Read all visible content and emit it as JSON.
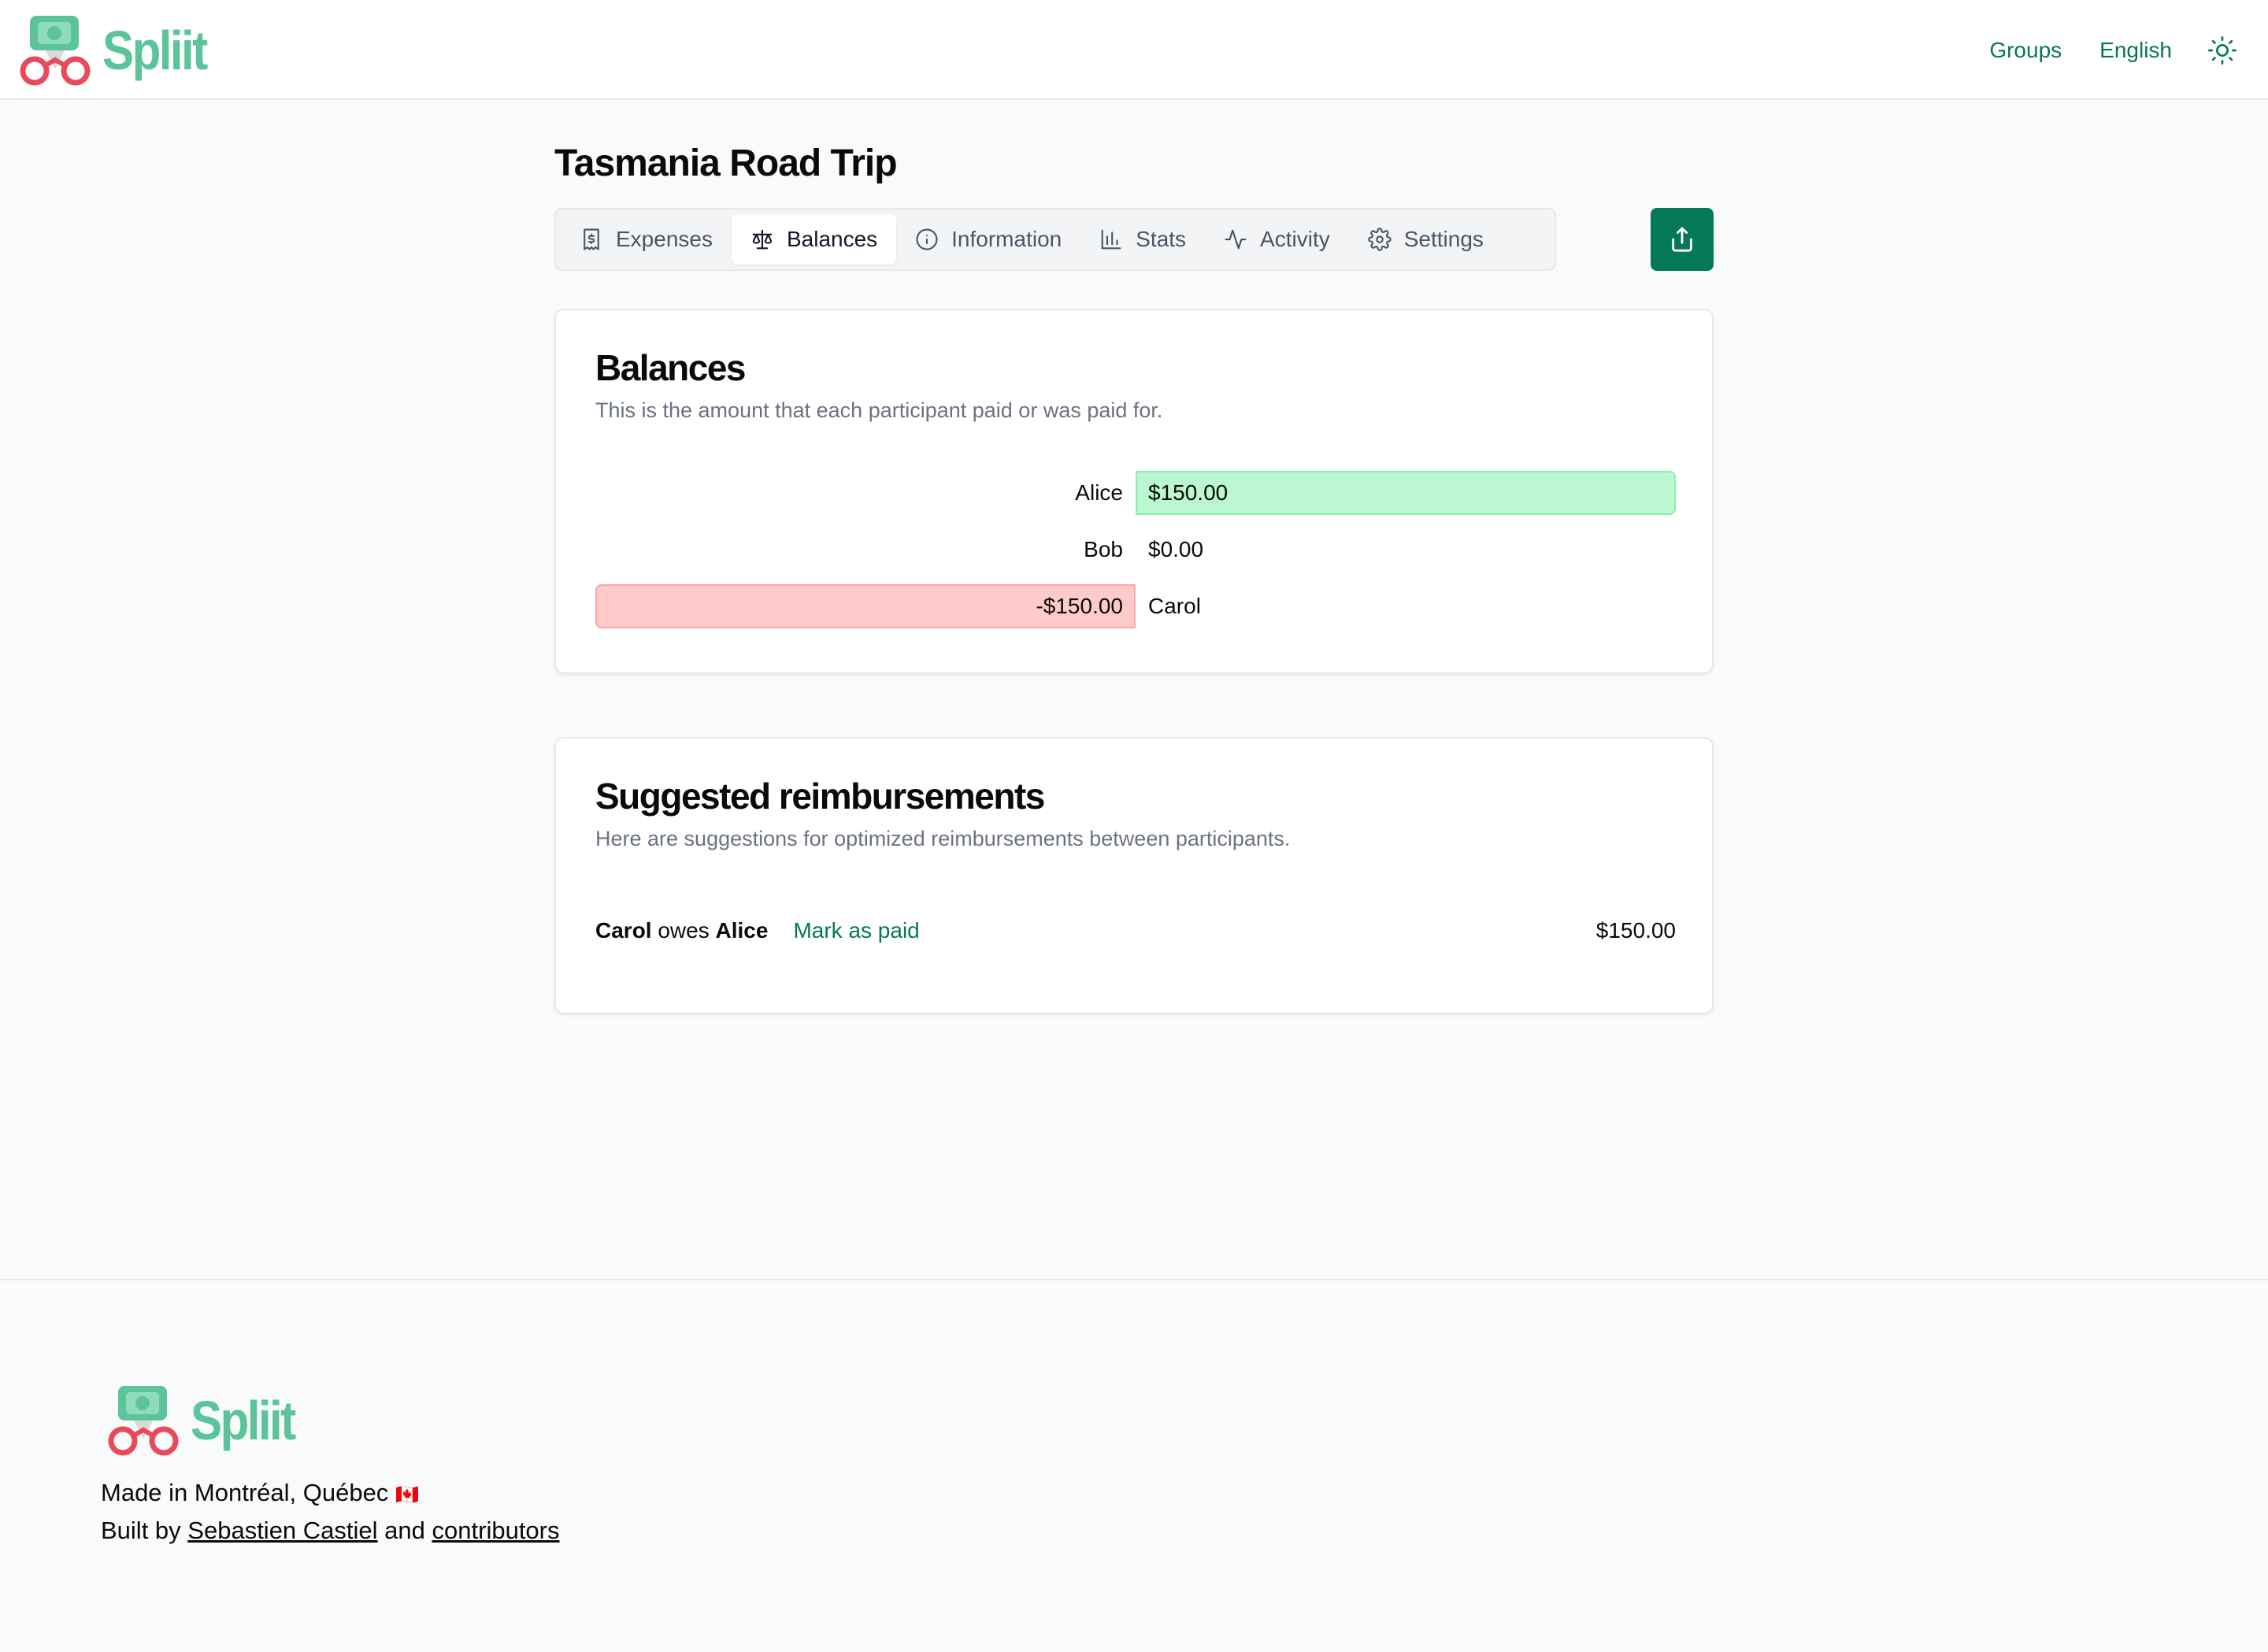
{
  "header": {
    "logo_text": "Spliit",
    "nav": {
      "groups": "Groups",
      "language": "English"
    }
  },
  "group": {
    "title": "Tasmania Road Trip"
  },
  "tabs": [
    {
      "label": "Expenses",
      "icon": "receipt-icon"
    },
    {
      "label": "Balances",
      "icon": "scale-icon",
      "active": true
    },
    {
      "label": "Information",
      "icon": "info-icon"
    },
    {
      "label": "Stats",
      "icon": "bar-chart-icon"
    },
    {
      "label": "Activity",
      "icon": "activity-icon"
    },
    {
      "label": "Settings",
      "icon": "gear-icon"
    }
  ],
  "balances": {
    "title": "Balances",
    "description": "This is the amount that each participant paid or was paid for.",
    "max_abs": 150,
    "rows": [
      {
        "name": "Alice",
        "amount": 150,
        "label": "$150.00"
      },
      {
        "name": "Bob",
        "amount": 0,
        "label": "$0.00"
      },
      {
        "name": "Carol",
        "amount": -150,
        "label": "-$150.00"
      }
    ],
    "colors": {
      "positive": "#bbf7d0",
      "negative": "#fecaca"
    }
  },
  "reimbursements": {
    "title": "Suggested reimbursements",
    "description": "Here are suggestions for optimized reimbursements between participants.",
    "items": [
      {
        "from": "Carol",
        "verb": "owes",
        "to": "Alice",
        "action": "Mark as paid",
        "amount": "$150.00"
      }
    ]
  },
  "footer": {
    "logo_text": "Spliit",
    "made_in": "Made in Montréal, Québec",
    "flag": "🇨🇦",
    "built_by_prefix": "Built by",
    "author": "Sebastien Castiel",
    "and": "and",
    "contributors": "contributors"
  },
  "colors": {
    "accent": "#047857",
    "logo": "#5bc49a"
  }
}
